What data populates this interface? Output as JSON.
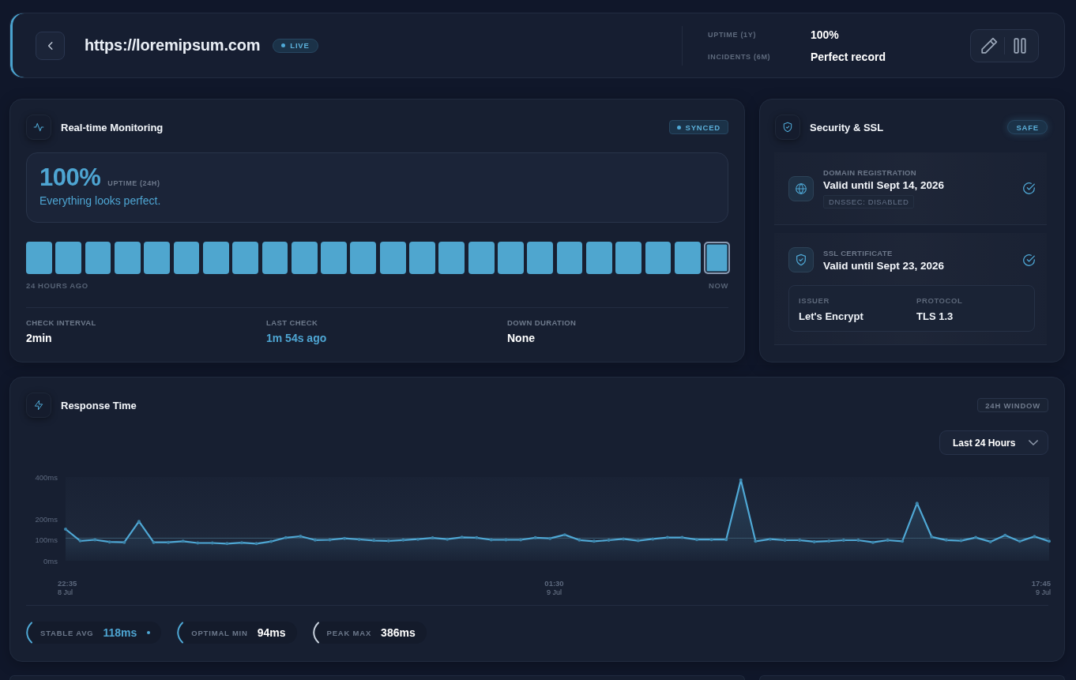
{
  "header": {
    "url": "https://loremipsum.com",
    "badge": {
      "label": "LIVE",
      "dot": true
    },
    "stats": [
      {
        "label": "UPTIME (1Y)",
        "value": "100%"
      },
      {
        "label": "INCIDENTS (6M)",
        "value": "Perfect record"
      }
    ]
  },
  "monitoring": {
    "title": "Real-time Monitoring",
    "badge": {
      "label": "SYNCED",
      "dot": true
    },
    "uptime": {
      "value": "100%",
      "label": "UPTIME (24H)",
      "message": "Everything looks perfect."
    },
    "heartbeats": [
      {
        "color": "#4fa6cf",
        "current": false
      },
      {
        "color": "#4fa6cf",
        "current": false
      },
      {
        "color": "#4fa6cf",
        "current": false
      },
      {
        "color": "#4fa6cf",
        "current": false
      },
      {
        "color": "#4fa6cf",
        "current": false
      },
      {
        "color": "#4fa6cf",
        "current": false
      },
      {
        "color": "#4fa6cf",
        "current": false
      },
      {
        "color": "#4fa6cf",
        "current": false
      },
      {
        "color": "#4fa6cf",
        "current": false
      },
      {
        "color": "#4fa6cf",
        "current": false
      },
      {
        "color": "#4fa6cf",
        "current": false
      },
      {
        "color": "#4fa6cf",
        "current": false
      },
      {
        "color": "#4fa6cf",
        "current": false
      },
      {
        "color": "#4fa6cf",
        "current": false
      },
      {
        "color": "#4fa6cf",
        "current": false
      },
      {
        "color": "#4fa6cf",
        "current": false
      },
      {
        "color": "#4fa6cf",
        "current": false
      },
      {
        "color": "#4fa6cf",
        "current": false
      },
      {
        "color": "#4fa6cf",
        "current": false
      },
      {
        "color": "#4fa6cf",
        "current": false
      },
      {
        "color": "#4fa6cf",
        "current": false
      },
      {
        "color": "#4fa6cf",
        "current": false
      },
      {
        "color": "#4fa6cf",
        "current": false
      },
      {
        "color": "#4fa6cf",
        "current": true
      }
    ],
    "start_label": "24 HOURS AGO",
    "end_label": "NOW",
    "metrics": [
      {
        "label": "CHECK INTERVAL",
        "value": "2min",
        "highlighted": false
      },
      {
        "label": "LAST CHECK",
        "value": "1m 54s ago",
        "highlighted": true
      },
      {
        "label": "DOWN DURATION",
        "value": "None",
        "highlighted": false
      }
    ]
  },
  "security": {
    "title": "Security & SSL",
    "badge": {
      "label": "SAFE",
      "dot": false
    },
    "items": [
      {
        "kind": "domain",
        "label": "DOMAIN REGISTRATION",
        "value": "Valid until Sept 14, 2026",
        "tag": "DNSSEC: DISABLED",
        "verified": true
      },
      {
        "kind": "ssl",
        "label": "SSL CERTIFICATE",
        "value": "Valid until Sept 23, 2026",
        "verified": true,
        "details": [
          {
            "label": "ISSUER",
            "value": "Let's Encrypt"
          },
          {
            "label": "PROTOCOL",
            "value": "TLS 1.3"
          }
        ]
      }
    ]
  },
  "response_time": {
    "badge": {
      "label": "24H WINDOW",
      "dot": false
    },
    "range_select": {
      "value": "Last 24 Hours"
    },
    "chart_data": {
      "type": "area",
      "title": "Response Time",
      "ylim": [
        0,
        400
      ],
      "yticks": [
        {
          "value": 0,
          "label": "0ms"
        },
        {
          "value": 100,
          "label": "100ms"
        },
        {
          "value": 200,
          "label": "200ms"
        },
        {
          "value": 400,
          "label": "400ms"
        }
      ],
      "series": [
        {
          "color": "#4fa8d5",
          "values": [
            151,
            95,
            100,
            90,
            88,
            188,
            88,
            88,
            93,
            85,
            85,
            82,
            86,
            82,
            92,
            110,
            117,
            99,
            100,
            107,
            102,
            97,
            95,
            99,
            103,
            109,
            103,
            112,
            110,
            100,
            100,
            100,
            110,
            107,
            124,
            99,
            93,
            98,
            104,
            96,
            104,
            111,
            111,
            101,
            101,
            101,
            386,
            93,
            103,
            98,
            98,
            91,
            94,
            98,
            98,
            88,
            98,
            93,
            275,
            114,
            99,
            96,
            111,
            91,
            122,
            93,
            116,
            93
          ]
        }
      ],
      "ref_lines": [
        {
          "axis": "y",
          "value": 108
        }
      ]
    },
    "time_axis": [
      {
        "time": "22:35",
        "date": "8 Jul"
      },
      {
        "time": "01:30",
        "date": "9 Jul"
      },
      {
        "time": "17:45",
        "date": "9 Jul"
      }
    ],
    "stats": [
      {
        "label": "STABLE AVG",
        "value": "118ms",
        "color": "#4fa8d5",
        "highlighted": true
      },
      {
        "label": "OPTIMAL MIN",
        "value": "94ms",
        "color": "#4fa8d5",
        "highlighted": false
      },
      {
        "label": "PEAK MAX",
        "value": "386ms",
        "color": "#c9d2de",
        "highlighted": false
      }
    ]
  }
}
